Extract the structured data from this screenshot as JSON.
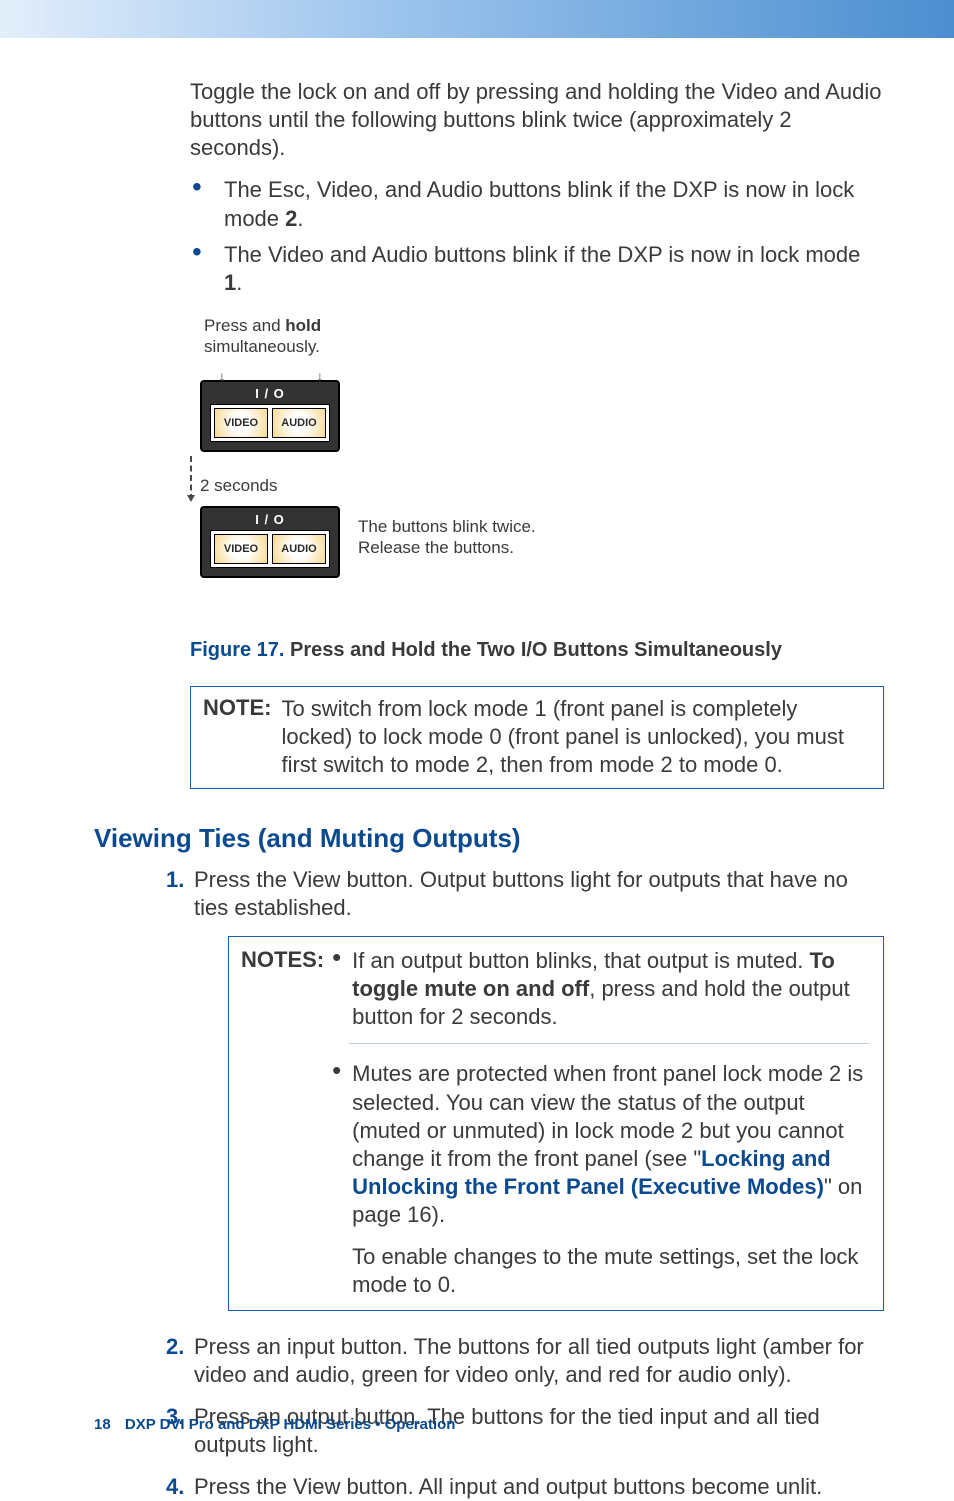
{
  "intro": "Toggle the lock on and off by pressing and holding the Video and Audio buttons until the following buttons blink twice (approximately 2 seconds).",
  "bullets": [
    {
      "pre": "The Esc, Video, and Audio buttons blink if the DXP is now in lock mode ",
      "bold": "2",
      "post": "."
    },
    {
      "pre": "The Video and Audio buttons blink if the DXP is now in lock mode ",
      "bold": "1",
      "post": "."
    }
  ],
  "diagram": {
    "press_hold_1": "Press and ",
    "press_hold_bold": "hold",
    "press_hold_2": "simultaneously.",
    "io_label": "I / O",
    "btn_video": "VIDEO",
    "btn_audio": "AUDIO",
    "two_seconds": "2 seconds",
    "caption_1": "The buttons blink twice.",
    "caption_2": "Release the buttons."
  },
  "figure": {
    "num": "Figure 17.",
    "caption": "Press and Hold the Two I/O Buttons Simultaneously"
  },
  "note": {
    "label": "NOTE:",
    "body": "To switch from lock mode 1 (front panel is completely locked) to lock mode 0 (front panel is unlocked), you must first switch to mode 2, then from mode 2 to mode 0."
  },
  "section_heading": "Viewing Ties (and Muting Outputs)",
  "steps": [
    {
      "n": "1.",
      "body": "Press the View button. Output buttons light for outputs that have no ties established."
    },
    {
      "n": "2.",
      "body": "Press an input button. The buttons for all tied outputs light (amber for video and audio, green for video only, and red for audio only)."
    },
    {
      "n": "3.",
      "body": "Press an output button. The buttons for the tied input and all tied outputs light."
    },
    {
      "n": "4.",
      "body": "Press the View button. All input and output buttons become unlit."
    }
  ],
  "notes_box": {
    "label": "NOTES:",
    "item1_pre": "If an output button blinks, that output is muted. ",
    "item1_bold": "To toggle mute on and off",
    "item1_post": ", press and hold the output button for 2 seconds.",
    "item2_pre": "Mutes are protected when front panel lock mode 2 is selected. You can view the status of the output (muted or unmuted) in lock mode 2 but you cannot change it from the front panel (see \"",
    "item2_link": "Locking and Unlocking the Front Panel (Executive Modes)",
    "item2_post": "\" on page 16).",
    "item2_follow": "To enable changes to the mute settings, set the lock mode to 0."
  },
  "footer": {
    "page": "18",
    "title": "DXP DVI Pro and DXP HDMI Series • Operation"
  }
}
